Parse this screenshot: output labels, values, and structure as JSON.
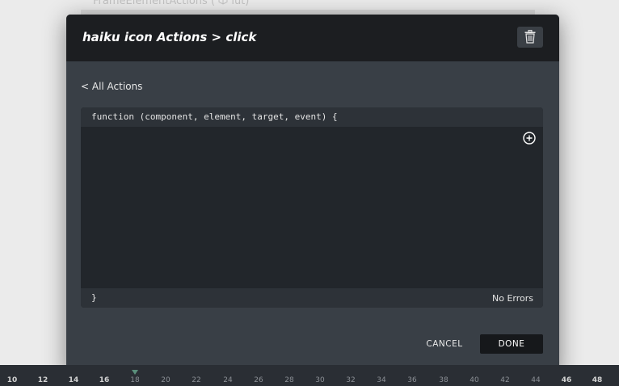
{
  "background": {
    "title": "FrameElementActions",
    "title_suffix": "lut)"
  },
  "modal": {
    "title": "haiku icon Actions > click",
    "back_label": "< All Actions",
    "editor": {
      "signature": "function (component, element, target, event) {",
      "closing": "}",
      "status": "No Errors"
    },
    "cancel_label": "CANCEL",
    "done_label": "DONE"
  },
  "timeline": {
    "ticks": [
      "10",
      "12",
      "14",
      "16",
      "18",
      "20",
      "22",
      "24",
      "26",
      "28",
      "30",
      "32",
      "34",
      "36",
      "38",
      "40",
      "42",
      "44",
      "46",
      "48"
    ]
  },
  "colors": {
    "header_bg": "#1c1e21",
    "modal_bg": "#393f46",
    "editor_bg": "#22262b",
    "done_bg": "#16181b"
  }
}
